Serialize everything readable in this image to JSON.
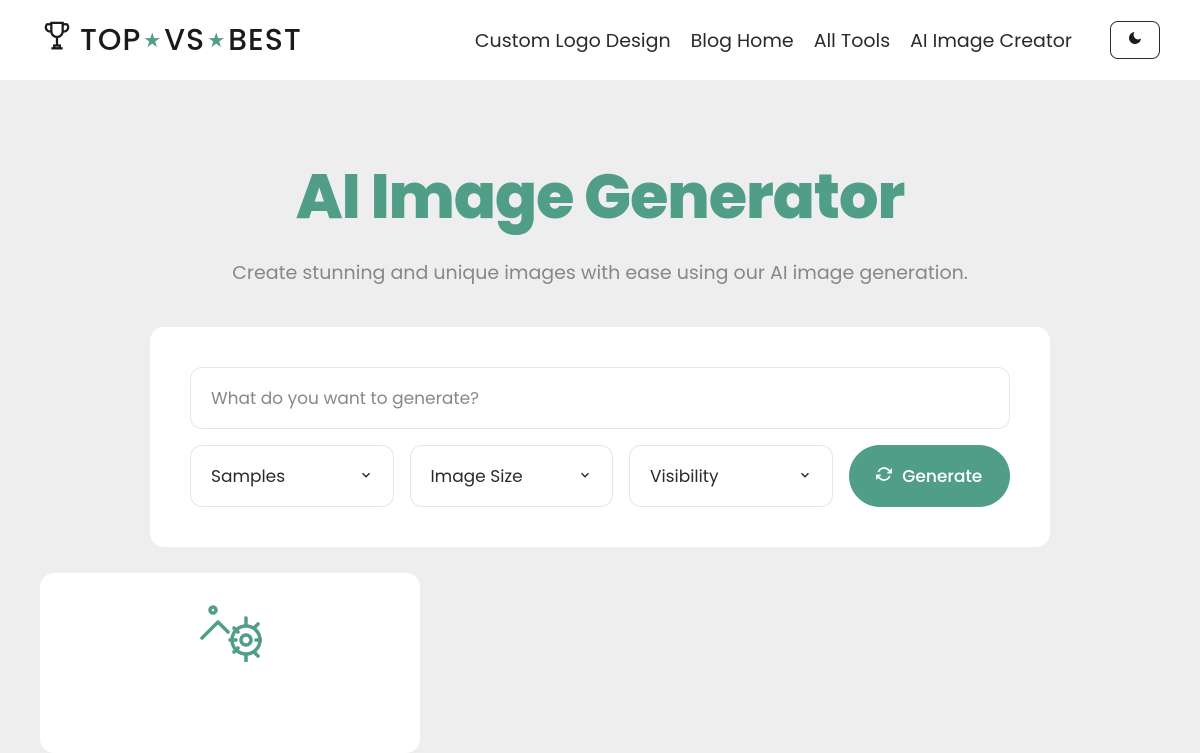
{
  "header": {
    "logo": {
      "part1": "TOP",
      "part2": "VS",
      "part3": "BEST"
    },
    "nav": [
      "Custom Logo Design",
      "Blog Home",
      "All Tools",
      "AI Image Creator"
    ]
  },
  "hero": {
    "title": "AI Image Generator",
    "subtitle": "Create stunning and unique images with ease using our AI image generation."
  },
  "form": {
    "prompt_placeholder": "What do you want to generate?",
    "select_samples": "Samples",
    "select_size": "Image Size",
    "select_visibility": "Visibility",
    "generate_label": "Generate"
  },
  "colors": {
    "accent": "#509e87",
    "page_bg": "#eeeeee",
    "panel_bg": "#ffffff",
    "muted": "#888888"
  }
}
